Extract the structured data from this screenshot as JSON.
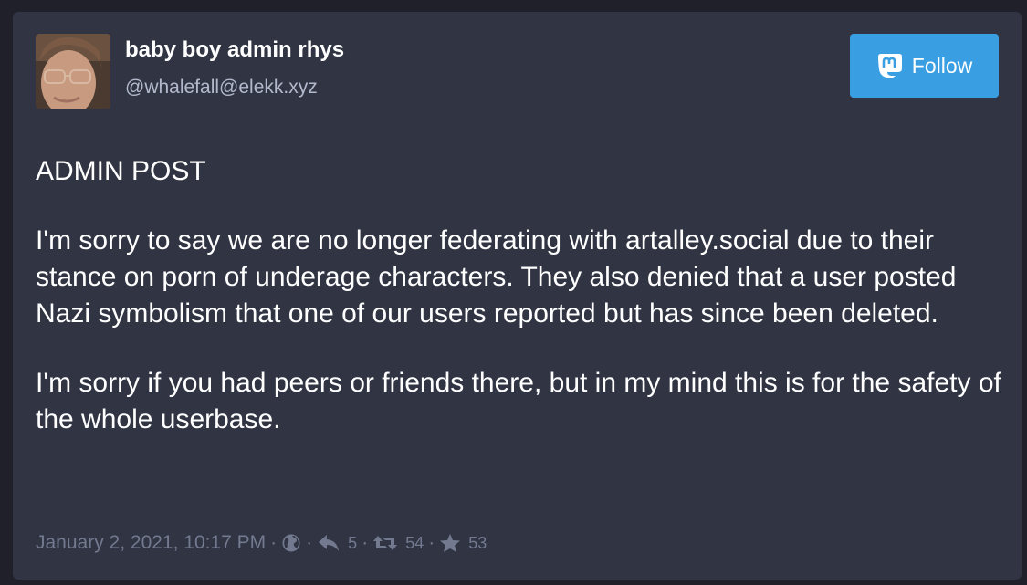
{
  "author": {
    "display_name": "baby boy admin rhys",
    "handle": "@whalefall@elekk.xyz"
  },
  "follow_button": {
    "label": "Follow",
    "icon": "mastodon-icon",
    "color": "#3a9fe2"
  },
  "post": {
    "paragraphs": [
      "ADMIN POST",
      "I'm sorry to say we are no longer federating with artalley.social due to their stance on porn of underage characters. They also denied that a user posted Nazi symbolism that one of our users reported but has since been deleted.",
      "I'm sorry if you had peers or friends there, but in my mind this is for the safety of the whole userbase."
    ],
    "timestamp": "January 2, 2021, 10:17 PM",
    "separator": "·",
    "visibility_icon": "globe-icon",
    "replies": "5",
    "boosts": "54",
    "favourites": "53"
  },
  "colors": {
    "background": "#1f2029",
    "card": "#313543",
    "text": "#ffffff",
    "muted": "#737a90"
  }
}
